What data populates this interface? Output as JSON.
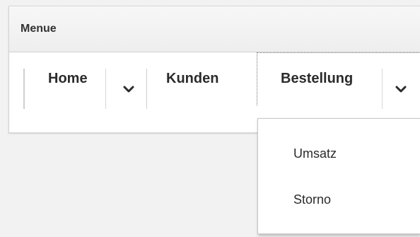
{
  "menu": {
    "title": "Menue",
    "items": [
      {
        "label": "Home",
        "has_submenu": true
      },
      {
        "label": "Kunden",
        "has_submenu": false
      },
      {
        "label": "Bestellung",
        "has_submenu": true,
        "expanded": true
      }
    ],
    "submenu": {
      "parent": "Bestellung",
      "items": [
        {
          "label": "Umsatz"
        },
        {
          "label": "Storno"
        }
      ]
    }
  },
  "icons": {
    "submenu_toggle": "chevron-down-icon"
  }
}
